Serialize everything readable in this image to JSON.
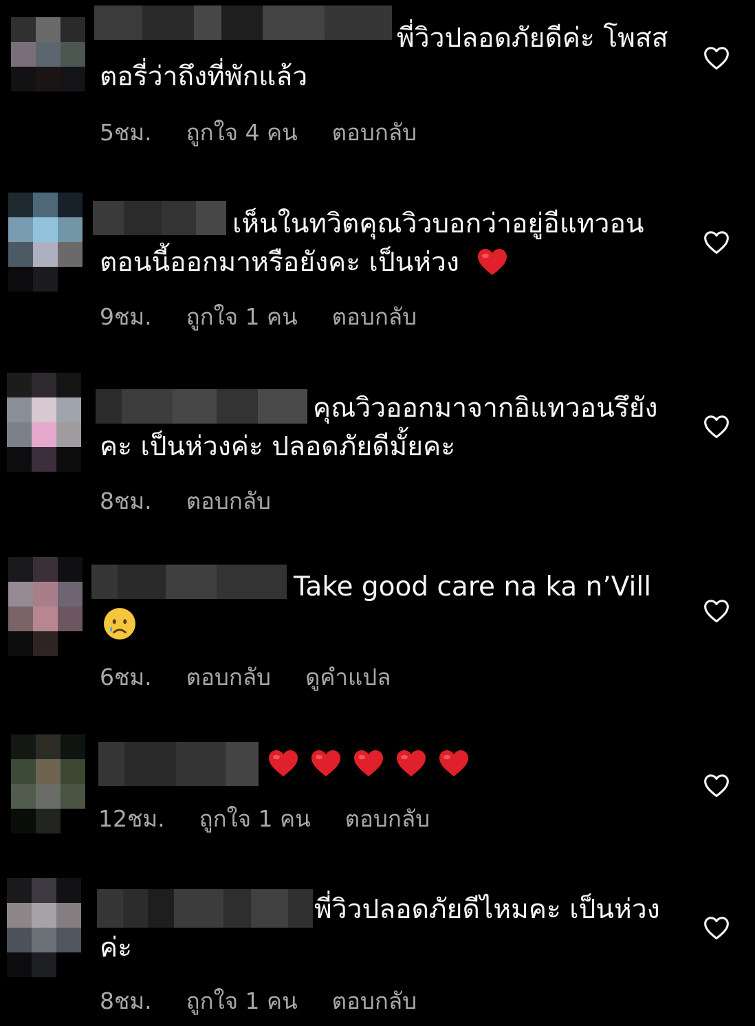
{
  "colors": {
    "background": "#000000",
    "text": "#f5f5f5",
    "meta": "#a8a8a8",
    "heart_outline": "#f5f5f5",
    "heart_emoji": "#e0202a"
  },
  "comments": [
    {
      "text": "พี่วิวปลอดภัยดีค่ะ โพสสตอรี่ว่าถึงที่พักแล้ว",
      "time": "5ชม.",
      "likes": "ถูกใจ 4 คน",
      "reply": "ตอบกลับ",
      "like_icon": "heart-outline-icon"
    },
    {
      "text": "เห็นในทวิตคุณวิวบอกว่าอยู่อีแทวอน ตอนนี้ออกมาหรือยังคะ เป็นห่วง",
      "emoji": "red-heart-emoji",
      "time": "9ชม.",
      "likes": "ถูกใจ 1 คน",
      "reply": "ตอบกลับ",
      "like_icon": "heart-outline-icon"
    },
    {
      "text": "คุณวิวออกมาจากอิแทวอนรึยังคะ เป็นห่วงค่ะ ปลอดภัยดีมั้ยคะ",
      "time": "8ชม.",
      "reply": "ตอบกลับ",
      "like_icon": "heart-outline-icon"
    },
    {
      "text": "Take good care na ka n’Vill",
      "emoji": "crying-face-emoji",
      "time": "6ชม.",
      "reply": "ตอบกลับ",
      "translate": "ดูคำแปล",
      "like_icon": "heart-outline-icon"
    },
    {
      "emoji": "red-heart-emoji",
      "emoji_count": 5,
      "time": "12ชม.",
      "likes": "ถูกใจ 1 คน",
      "reply": "ตอบกลับ",
      "like_icon": "heart-outline-icon"
    },
    {
      "text": "พี่วิวปลอดภัยดีไหมคะ เป็นห่วงค่ะ",
      "time": "8ชม.",
      "likes": "ถูกใจ 1 คน",
      "reply": "ตอบกลับ",
      "like_icon": "heart-outline-icon"
    }
  ]
}
